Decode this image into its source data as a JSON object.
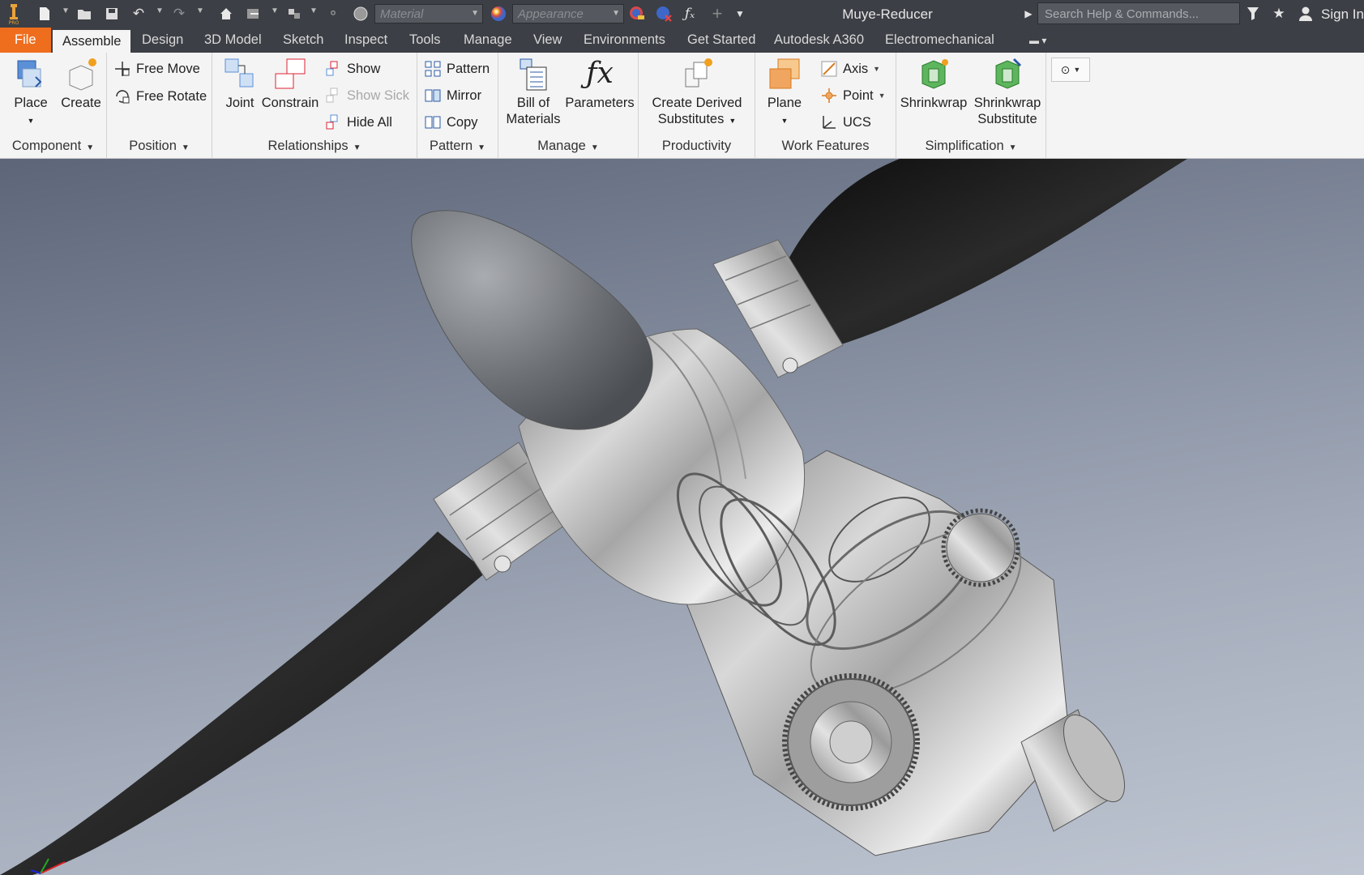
{
  "app": {
    "document_title": "Muye-Reducer",
    "search_placeholder": "Search Help & Commands...",
    "sign_in": "Sign In"
  },
  "quick_access": {
    "material_placeholder": "Material",
    "appearance_placeholder": "Appearance",
    "icons": [
      "new-icon",
      "open-icon",
      "save-icon",
      "undo-icon",
      "redo-icon",
      "home-icon",
      "return-icon",
      "select-icon",
      "update-icon",
      "material-sphere-icon",
      "appearance-sphere-icon",
      "adjust-appearance-icon",
      "clear-appearance-icon",
      "fx-icon",
      "plus-icon",
      "customize-icon",
      "help-star-icon",
      "user-icon"
    ]
  },
  "tabs": [
    {
      "label": "File"
    },
    {
      "label": "Assemble"
    },
    {
      "label": "Design"
    },
    {
      "label": "3D Model"
    },
    {
      "label": "Sketch"
    },
    {
      "label": "Inspect"
    },
    {
      "label": "Tools"
    },
    {
      "label": "Manage"
    },
    {
      "label": "View"
    },
    {
      "label": "Environments"
    },
    {
      "label": "Get Started"
    },
    {
      "label": "Autodesk A360"
    },
    {
      "label": "Electromechanical"
    }
  ],
  "ribbon": {
    "component": {
      "label": "Component",
      "place": "Place",
      "create": "Create"
    },
    "position": {
      "label": "Position",
      "free_move": "Free Move",
      "free_rotate": "Free Rotate"
    },
    "relationships": {
      "label": "Relationships",
      "joint": "Joint",
      "constrain": "Constrain",
      "show": "Show",
      "show_sick": "Show Sick",
      "hide_all": "Hide All"
    },
    "pattern": {
      "label": "Pattern",
      "pattern": "Pattern",
      "mirror": "Mirror",
      "copy": "Copy"
    },
    "manage": {
      "label": "Manage",
      "bom_line1": "Bill of",
      "bom_line2": "Materials",
      "parameters": "Parameters"
    },
    "productivity": {
      "label": "Productivity",
      "derived_line1": "Create Derived",
      "derived_line2": "Substitutes"
    },
    "work_features": {
      "label": "Work Features",
      "plane": "Plane",
      "axis": "Axis",
      "point": "Point",
      "ucs": "UCS"
    },
    "simplification": {
      "label": "Simplification",
      "shrinkwrap": "Shrinkwrap",
      "shrinkwrap_sub_line1": "Shrinkwrap",
      "shrinkwrap_sub_line2": "Substitute"
    }
  },
  "colors": {
    "titlebar": "#3c3f45",
    "file_tab": "#ef6e1e",
    "ribbon": "#f4f4f4",
    "blade": "#1c1c1c",
    "metal": "#b9b9b9"
  }
}
